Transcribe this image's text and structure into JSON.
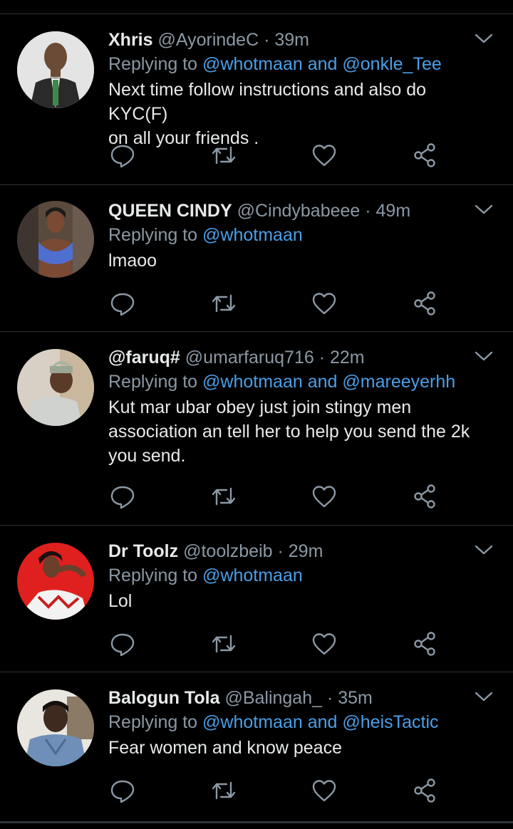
{
  "colors": {
    "background": "#000000",
    "primary_text": "#e7e9ea",
    "secondary_text": "#8b98a5",
    "mention": "#4a9fe8",
    "divider": "#2f3336"
  },
  "replying_prefix": "Replying to",
  "and_word": "and",
  "tweets": [
    {
      "name": "Xhris",
      "handle": "@AyorindeC",
      "time": "39m",
      "mentions": [
        "@whotmaan",
        "@onkle_Tee"
      ],
      "lines": [
        "Next time follow instructions and also do KYC(F)",
        "on all your friends ."
      ]
    },
    {
      "name": "QUEEN CINDY",
      "handle": "@Cindybabeee",
      "time": "49m",
      "mentions": [
        "@whotmaan"
      ],
      "lines": [
        "lmaoo"
      ]
    },
    {
      "name": "@faruq#",
      "handle": "@umarfaruq716",
      "time": "22m",
      "mentions": [
        "@whotmaan",
        "@mareeyerhh"
      ],
      "lines": [
        "Kut mar ubar obey just join stingy men",
        "association an tell her to help you send the 2k",
        "you send."
      ]
    },
    {
      "name": "Dr Toolz",
      "handle": "@toolzbeib",
      "time": "29m",
      "mentions": [
        "@whotmaan"
      ],
      "lines": [
        "Lol"
      ]
    },
    {
      "name": "Balogun Tola",
      "handle": "@Balingah_",
      "time": "35m",
      "mentions": [
        "@whotmaan",
        "@heisTactic"
      ],
      "lines": [
        "Fear women and know peace"
      ]
    }
  ],
  "icons": {
    "reply": "reply-icon",
    "retweet": "retweet-icon",
    "like": "heart-icon",
    "share": "share-icon",
    "more": "chevron-down-icon"
  }
}
